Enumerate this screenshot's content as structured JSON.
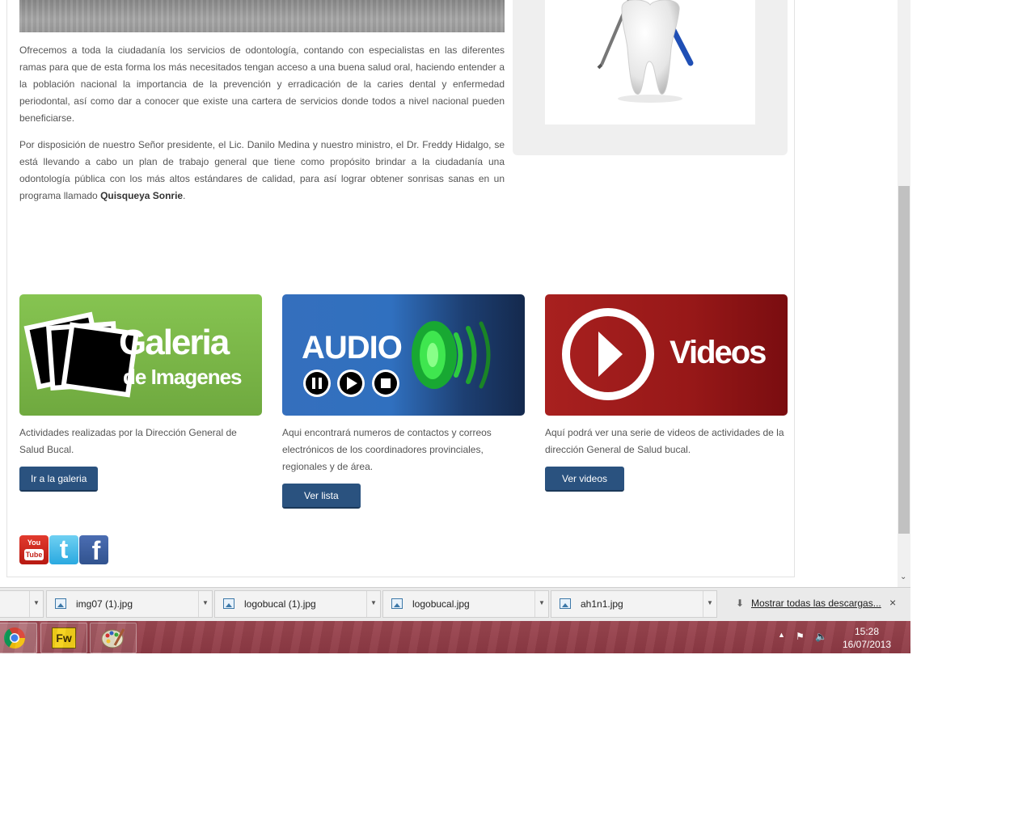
{
  "article": {
    "p1": "Ofrecemos a toda la ciudadanía los servicios de odontología, contando con especialistas en las diferentes ramas para que de esta forma los más necesitados tengan acceso a una buena salud oral, haciendo entender a la población nacional la importancia de la prevención y erradicación de la caries dental y enfermedad periodontal, así como dar a conocer que existe una cartera de servicios donde todos a nivel nacional pueden beneficiarse.",
    "p2_before": "Por disposición de nuestro Señor presidente, el Lic. Danilo Medina y nuestro ministro, el Dr. Freddy Hidalgo, se está llevando a cabo un plan de trabajo general que tiene como propósito brindar a la ciudadanía una odontología pública con los más altos estándares de calidad, para así lograr obtener sonrisas sanas en un programa llamado ",
    "p2_bold": "Quisqueya Sonrie",
    "p2_after": "."
  },
  "cards": {
    "gallery": {
      "banner_line1": "Galeria",
      "banner_line2": "de Imagenes",
      "text": "Actividades realizadas por la Dirección General de Salud Bucal.",
      "button": "Ir a la galeria",
      "color": "#7ab648"
    },
    "audio": {
      "banner_title": "AUDIO",
      "text": "Aqui encontrará numeros de contactos y correos electrónicos de los coordinadores provinciales, regionales y de área.",
      "button": "Ver lista",
      "color": "#2f6db8"
    },
    "videos": {
      "banner_title": "Videos",
      "text": "Aquí podrá ver una serie de videos de actividades de la dirección General de Salud bucal.",
      "button": "Ver videos",
      "color": "#a01d1d"
    }
  },
  "social": {
    "youtube_you": "You",
    "youtube_tube": "Tube",
    "twitter_letter": "t",
    "facebook_letter": "f"
  },
  "downloads": {
    "items": [
      "img07 (1).jpg",
      "logobucal (1).jpg",
      "logobucal.jpg",
      "ah1n1.jpg"
    ],
    "show_all": "Mostrar todas las descargas...",
    "close": "×"
  },
  "taskbar": {
    "fw_label": "Fw",
    "time": "15:28",
    "date": "16/07/2013"
  }
}
